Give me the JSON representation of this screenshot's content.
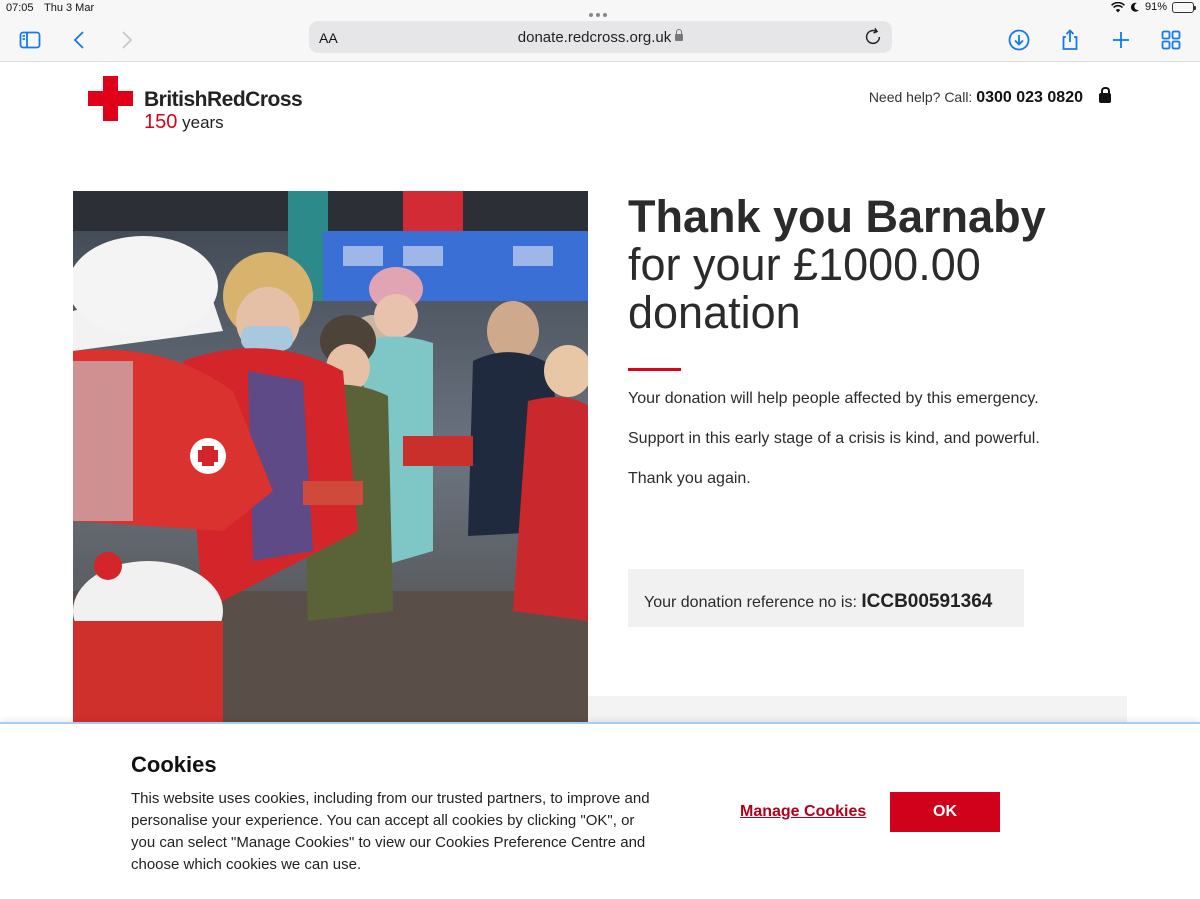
{
  "status_bar": {
    "time": "07:05",
    "date": "Thu 3 Mar",
    "battery": "91%",
    "battery_level": 0.91
  },
  "browser": {
    "text_size_label": "AA",
    "url": "donate.redcross.org.uk"
  },
  "header": {
    "brand_name": "BritishRedCross",
    "years_number": "150",
    "years_word": "years",
    "help_label": "Need help? Call:",
    "help_phone": "0300 023 0820"
  },
  "main": {
    "thanks_line": "Thank you Barnaby",
    "donation_line_1": "for your £1000.00",
    "donation_line_2": "donation",
    "para_1": "Your donation will help people affected by this emergency.",
    "para_2": "Support in this early stage of a crisis is kind, and powerful.",
    "para_3": "Thank you again.",
    "reference_label": "Your donation reference no is:",
    "reference_code": "ICCB00591364"
  },
  "cookies": {
    "title": "Cookies",
    "body": "This website uses cookies, including from our trusted partners, to improve and personalise your experience. You can accept all cookies by clicking \"OK\", or you can select \"Manage Cookies\" to view our Cookies Preference Centre and choose which cookies we can use.",
    "manage_label": "Manage Cookies",
    "ok_label": "OK"
  },
  "colors": {
    "brand_red": "#e1001a",
    "button_red": "#d0011b",
    "link_red": "#b3001b",
    "safari_blue": "#1478f0"
  }
}
